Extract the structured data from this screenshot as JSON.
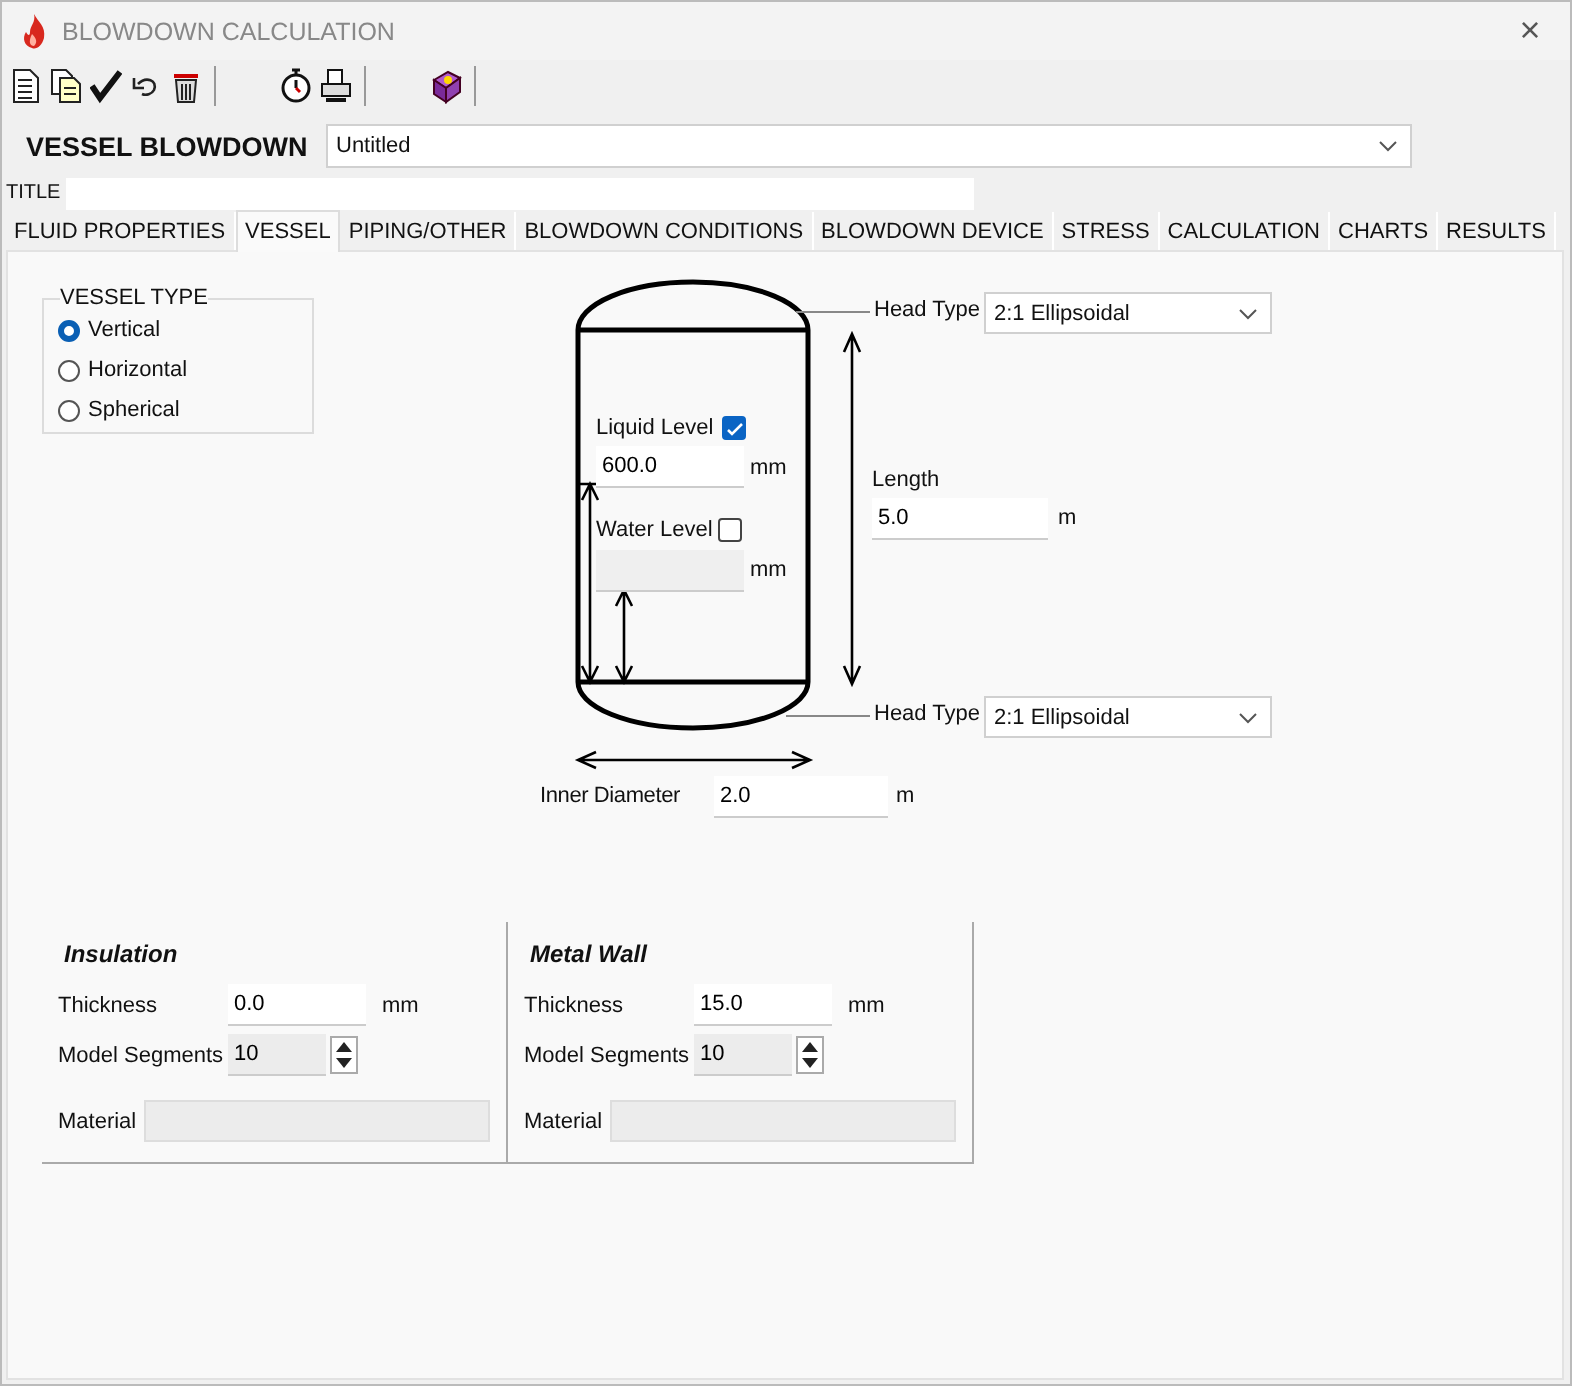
{
  "window": {
    "title": "BLOWDOWN CALCULATION",
    "close": "×"
  },
  "header": {
    "label": "VESSEL BLOWDOWN",
    "file_combo": {
      "value": "Untitled"
    }
  },
  "title_field": {
    "label": "TITLE"
  },
  "tabs": [
    {
      "label": "FLUID PROPERTIES",
      "selected": false
    },
    {
      "label": "VESSEL",
      "selected": true
    },
    {
      "label": "PIPING/OTHER",
      "selected": false
    },
    {
      "label": "BLOWDOWN CONDITIONS",
      "selected": false
    },
    {
      "label": "BLOWDOWN DEVICE",
      "selected": false
    },
    {
      "label": "STRESS",
      "selected": false
    },
    {
      "label": "CALCULATION",
      "selected": false
    },
    {
      "label": "CHARTS",
      "selected": false
    },
    {
      "label": "RESULTS",
      "selected": false
    }
  ],
  "vessel_type": {
    "title": "VESSEL TYPE",
    "options": [
      {
        "label": "Vertical",
        "selected": true
      },
      {
        "label": "Horizontal",
        "selected": false
      },
      {
        "label": "Spherical",
        "selected": false
      }
    ]
  },
  "diagram": {
    "head_type_top": {
      "label": "Head Type",
      "value": "2:1 Ellipsoidal"
    },
    "liquid_level": {
      "label": "Liquid Level",
      "checked": true,
      "value": "600.0",
      "unit": "mm",
      "disabled": false
    },
    "water_level": {
      "label": "Water Level",
      "checked": false,
      "unit": "mm",
      "disabled": true
    },
    "length": {
      "label": "Length",
      "value": "5.0",
      "unit": "m"
    },
    "head_type_bottom": {
      "label": "Head Type",
      "value": "2:1 Ellipsoidal"
    },
    "inner_diameter": {
      "label": "Inner Diameter",
      "value": "2.0",
      "unit": "m"
    }
  },
  "layers": [
    {
      "title": "Insulation",
      "thickness": {
        "label": "Thickness",
        "value": "0.0",
        "unit": "mm"
      },
      "segments": {
        "label": "Model Segments",
        "value": "10",
        "disabled": true
      },
      "material": {
        "label": "Material",
        "disabled": true
      }
    },
    {
      "title": "Metal Wall",
      "thickness": {
        "label": "Thickness",
        "value": "15.0",
        "unit": "mm"
      },
      "segments": {
        "label": "Model Segments",
        "value": "10",
        "disabled": true
      },
      "material": {
        "label": "Material",
        "disabled": true
      }
    }
  ]
}
